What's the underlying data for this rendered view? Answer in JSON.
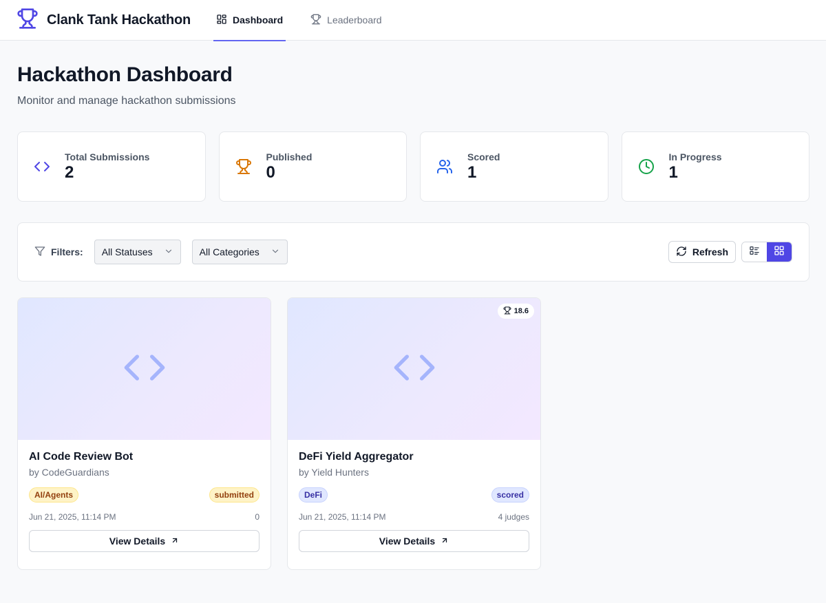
{
  "app": {
    "title": "Clank Tank Hackathon"
  },
  "nav": {
    "dashboard": "Dashboard",
    "leaderboard": "Leaderboard"
  },
  "page": {
    "title": "Hackathon Dashboard",
    "subtitle": "Monitor and manage hackathon submissions"
  },
  "stats": [
    {
      "label": "Total Submissions",
      "value": "2",
      "icon": "code-icon",
      "color": "#4f46e5"
    },
    {
      "label": "Published",
      "value": "0",
      "icon": "trophy-icon",
      "color": "#d97706"
    },
    {
      "label": "Scored",
      "value": "1",
      "icon": "users-icon",
      "color": "#2563eb"
    },
    {
      "label": "In Progress",
      "value": "1",
      "icon": "clock-icon",
      "color": "#16a34a"
    }
  ],
  "filters": {
    "label": "Filters:",
    "status": "All Statuses",
    "category": "All Categories",
    "refresh": "Refresh"
  },
  "submissions": [
    {
      "title": "AI Code Review Bot",
      "team": "by CodeGuardians",
      "category": "AI/Agents",
      "status": "submitted",
      "date": "Jun 21, 2025, 11:14 PM",
      "judges": "0",
      "action": "View Details"
    },
    {
      "title": "DeFi Yield Aggregator",
      "team": "by Yield Hunters",
      "category": "DeFi",
      "status": "scored",
      "score": "18.6",
      "date": "Jun 21, 2025, 11:14 PM",
      "judges": "4 judges",
      "action": "View Details"
    }
  ],
  "colors": {
    "accent": "#4f46e5",
    "brand": "#4f46e5"
  }
}
